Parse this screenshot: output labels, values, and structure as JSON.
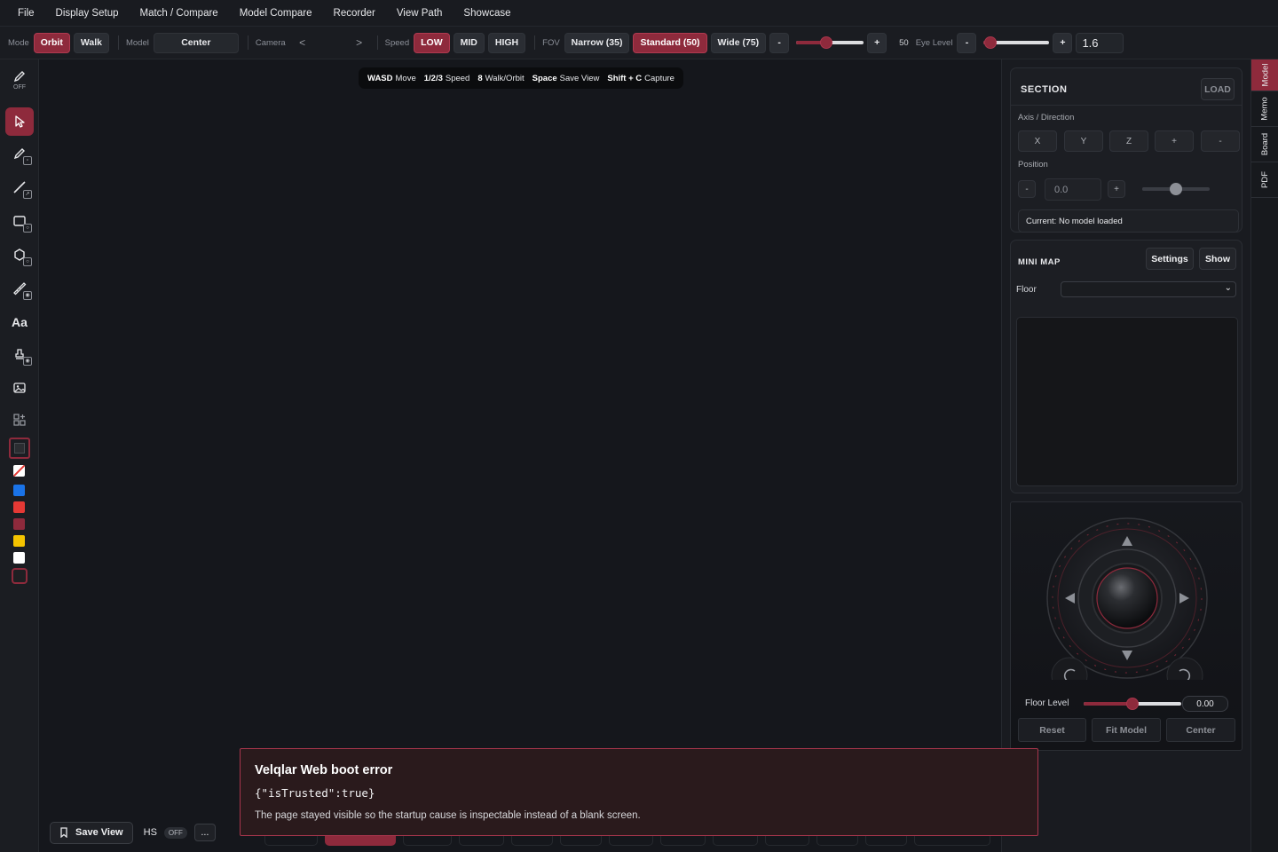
{
  "menu": [
    "File",
    "Display Setup",
    "Match / Compare",
    "Model Compare",
    "Recorder",
    "View Path",
    "Showcase"
  ],
  "toolbar": {
    "mode_label": "Mode",
    "mode_orbit": "Orbit",
    "mode_walk": "Walk",
    "model_label": "Model",
    "model_value": "Center",
    "camera_label": "Camera",
    "camera_prev": "<",
    "camera_next": ">",
    "speed_label": "Speed",
    "speed_low": "LOW",
    "speed_mid": "MID",
    "speed_high": "HIGH",
    "fov_label": "FOV",
    "fov_narrow": "Narrow (35)",
    "fov_standard": "Standard (50)",
    "fov_wide": "Wide (75)",
    "fov_minus": "-",
    "fov_plus": "+",
    "fov_slider_fraction": 0.45,
    "fov_value": "50",
    "eye_label": "Eye Level",
    "eye_minus": "-",
    "eye_plus": "+",
    "eye_slider_fraction": 0.1,
    "eye_value": "1.6"
  },
  "leftrail": {
    "pen_state": "OFF",
    "text_tool": "Aa",
    "swatch_colors": [
      "#1a73e8",
      "#e53935",
      "#8e2a3c",
      "#f5c400",
      "#ffffff"
    ]
  },
  "hint": {
    "items": [
      {
        "key": "WASD",
        "text": "Move"
      },
      {
        "key": "1/2/3",
        "text": "Speed"
      },
      {
        "key": "8",
        "text": "Walk/Orbit"
      },
      {
        "key": "Space",
        "text": "Save View"
      },
      {
        "key": "Shift + C",
        "text": "Capture"
      }
    ]
  },
  "bottom": {
    "save_view": "Save View",
    "hs": "HS",
    "hs_state": "OFF",
    "more": "..."
  },
  "section": {
    "title": "SECTION",
    "load": "LOAD",
    "axis_label": "Axis / Direction",
    "axis_buttons": [
      "X",
      "Y",
      "Z",
      "+",
      "-"
    ],
    "position_label": "Position",
    "pos_minus": "-",
    "pos_value": "0.0",
    "pos_plus": "+",
    "pos_slider_fraction": 0.5,
    "current": "Current: No model loaded"
  },
  "minimap": {
    "title": "MINI MAP",
    "settings": "Settings",
    "show": "Show",
    "floor_label": "Floor"
  },
  "nav": {
    "floor_level_label": "Floor Level",
    "floor_level_fraction": 0.5,
    "floor_level_value": "0.00",
    "reset": "Reset",
    "fit_model": "Fit Model",
    "center": "Center"
  },
  "vtabs": [
    "Model",
    "Memo",
    "Board",
    "PDF"
  ],
  "error": {
    "title": "Velqlar Web boot error",
    "code": "{\"isTrusted\":true}",
    "message": "The page stayed visible so the startup cause is inspectable instead of a blank screen."
  },
  "colors": {
    "accent": "#8e2a3c",
    "background": "#15171c",
    "panel": "#191b20"
  }
}
